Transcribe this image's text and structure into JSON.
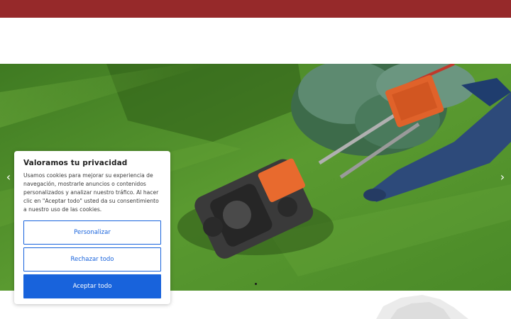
{
  "colors": {
    "topbar": "#96292a",
    "accent": "#1863dc",
    "grass": "#4d8a2a"
  },
  "slider": {
    "prev_icon": "chevron-left-icon",
    "prev_glyph": "‹",
    "next_icon": "chevron-right-icon",
    "next_glyph": "›",
    "hero_image": "lawn-mower-on-grass"
  },
  "cookie_banner": {
    "title": "Valoramos tu privacidad",
    "body": "Usamos cookies para mejorar su experiencia de navegación, mostrarle anuncios o contenidos personalizados y analizar nuestro tráfico. Al hacer clic en \"Aceptar todo\" usted da su consentimiento a nuestro uso de las cookies.",
    "customize_label": "Personalizar",
    "reject_label": "Rechazar todo",
    "accept_label": "Aceptar todo"
  }
}
